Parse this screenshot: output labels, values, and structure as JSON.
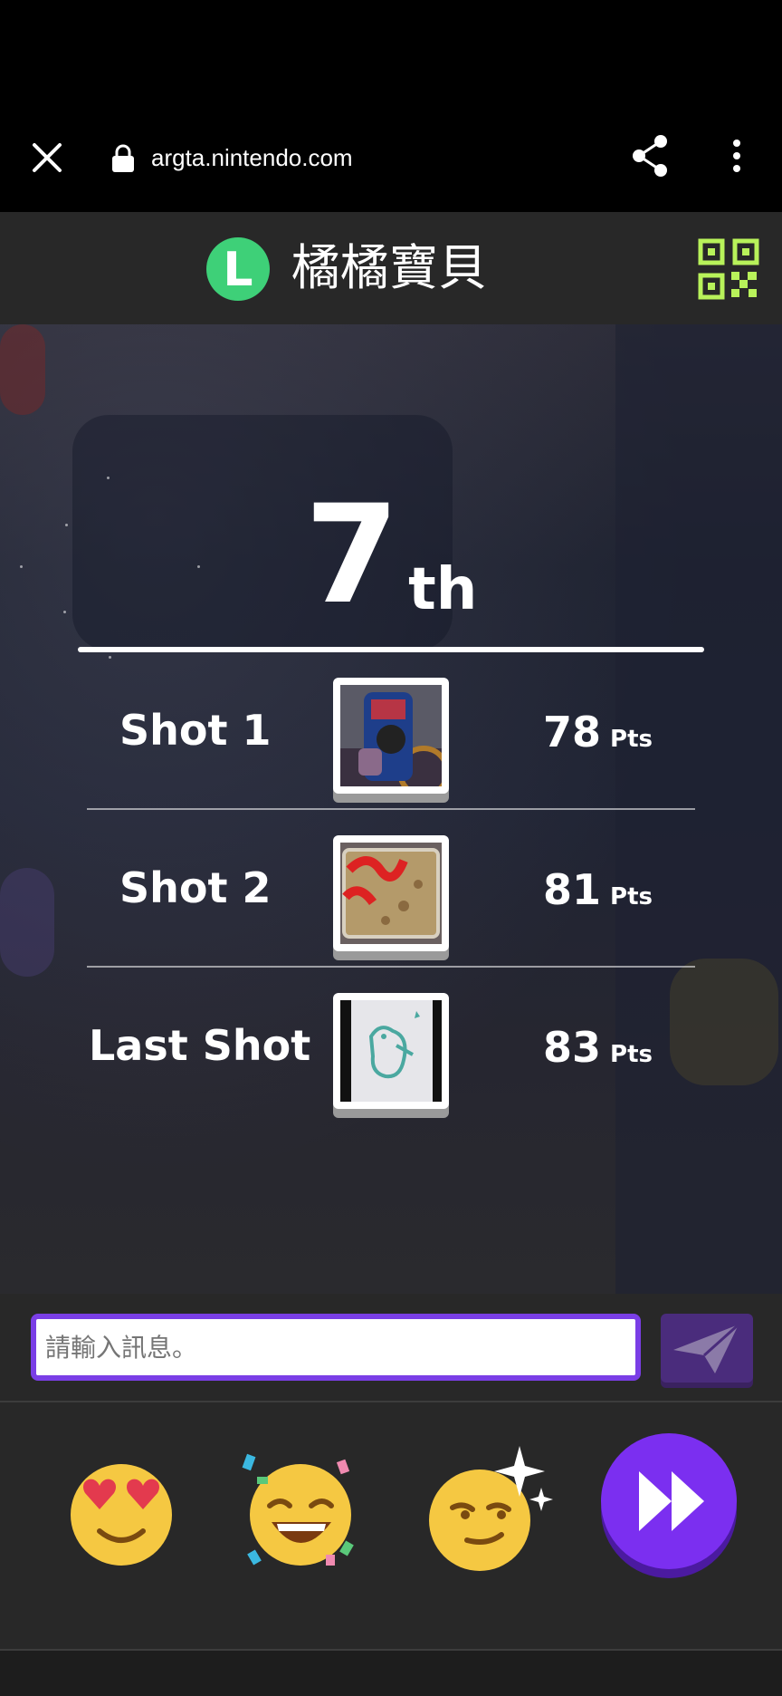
{
  "browser": {
    "url": "argta.nintendo.com"
  },
  "header": {
    "avatar_letter": "L",
    "avatar_color": "#3ed078",
    "player_name": "橘橘寶貝"
  },
  "result": {
    "rank_number": "7",
    "rank_suffix": "th",
    "shots": [
      {
        "label": "Shot 1",
        "score": "78",
        "unit": "Pts"
      },
      {
        "label": "Shot 2",
        "score": "81",
        "unit": "Pts"
      },
      {
        "label": "Last Shot",
        "score": "83",
        "unit": "Pts"
      }
    ]
  },
  "message": {
    "placeholder": "請輸入訊息。"
  },
  "reactions": [
    "heart-eyes-emoji",
    "laughing-party-emoji",
    "smirk-sparkle-emoji"
  ],
  "colors": {
    "accent": "#7b2ff0",
    "qr": "#b8f25a"
  }
}
